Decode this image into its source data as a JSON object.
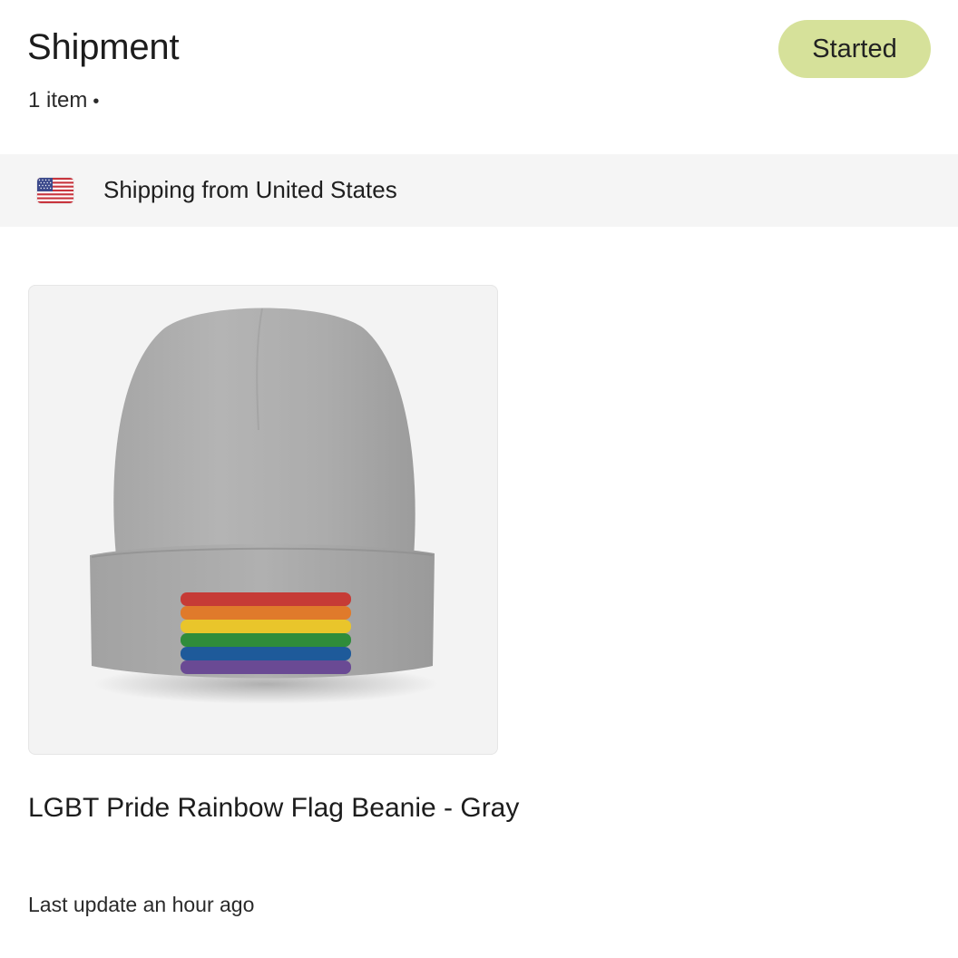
{
  "shipment": {
    "title": "Shipment",
    "item_count": "1 item",
    "separator": "•",
    "status": "Started",
    "status_color": "#d6e19a"
  },
  "origin": {
    "flag_icon": "us-flag-icon",
    "text": "Shipping from United States"
  },
  "product": {
    "image_icon": "beanie-product-image",
    "name": "LGBT Pride Rainbow Flag Beanie - Gray",
    "last_update": "Last update an hour ago"
  }
}
